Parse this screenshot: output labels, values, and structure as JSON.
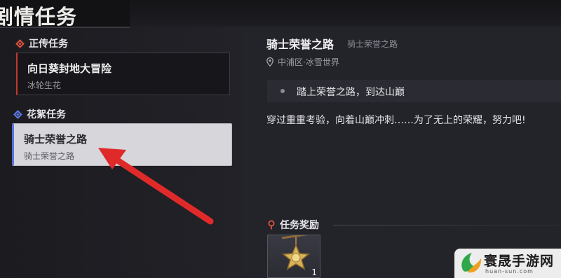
{
  "header": {
    "title": "剧情任务"
  },
  "left_panel": {
    "main_section_label": "正传任务",
    "main_quest": {
      "title": "向日葵封地大冒险",
      "subtitle": "冰轮生花"
    },
    "side_section_label": "花絮任务",
    "side_quest": {
      "title": "骑士荣誉之路",
      "subtitle": "骑士荣誉之路"
    }
  },
  "detail": {
    "title": "骑士荣誉之路",
    "subtitle": "骑士荣誉之路",
    "location": "中浦区·冰雪世界",
    "objective": "踏上荣誉之路，到达山巅",
    "description": "穿过重重考验，向着山巅冲刺……为了无上的荣耀，努力吧!",
    "reward_label": "任务奖励",
    "reward_count": "1"
  },
  "watermark": {
    "text": "寰晟手游网",
    "url": "huan-sun.com"
  },
  "colors": {
    "main_accent": "#c0392b",
    "side_accent": "#5a74d6",
    "arrow": "#e02a2a"
  }
}
